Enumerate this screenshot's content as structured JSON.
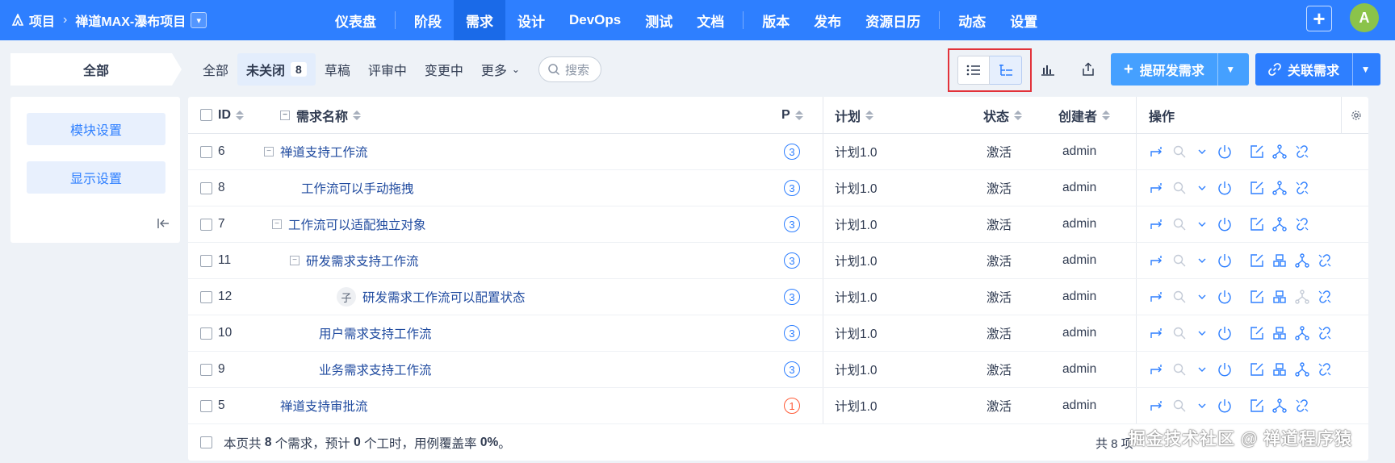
{
  "nav": {
    "crumb_project": "项目",
    "crumb_name": "禅道MAX-瀑布项目",
    "menu": [
      "仪表盘",
      "阶段",
      "需求",
      "设计",
      "DevOps",
      "测试",
      "文档",
      "版本",
      "发布",
      "资源日历",
      "动态",
      "设置"
    ],
    "active": "需求",
    "avatar": "A"
  },
  "module": {
    "all_label": "全部"
  },
  "filters": {
    "all": "全部",
    "unclosed": "未关闭",
    "unclosed_count": "8",
    "draft": "草稿",
    "reviewing": "评审中",
    "changing": "变更中",
    "more": "更多",
    "search_placeholder": "搜索"
  },
  "actions": {
    "create": "提研发需求",
    "link": "关联需求"
  },
  "sidebar": {
    "module_settings": "模块设置",
    "display_settings": "显示设置"
  },
  "table": {
    "headers": {
      "id": "ID",
      "name": "需求名称",
      "pri": "P",
      "plan": "计划",
      "status": "状态",
      "creator": "创建者",
      "actions": "操作"
    },
    "rows": [
      {
        "id": "6",
        "name": "禅道支持工作流",
        "pri": "3",
        "plan": "计划1.0",
        "status": "激活",
        "creator": "admin"
      },
      {
        "id": "8",
        "name": "工作流可以手动拖拽",
        "pri": "3",
        "plan": "计划1.0",
        "status": "激活",
        "creator": "admin"
      },
      {
        "id": "7",
        "name": "工作流可以适配独立对象",
        "pri": "3",
        "plan": "计划1.0",
        "status": "激活",
        "creator": "admin"
      },
      {
        "id": "11",
        "name": "研发需求支持工作流",
        "pri": "3",
        "plan": "计划1.0",
        "status": "激活",
        "creator": "admin"
      },
      {
        "id": "12",
        "name": "研发需求工作流可以配置状态",
        "pri": "3",
        "plan": "计划1.0",
        "status": "激活",
        "creator": "admin",
        "badge": "子"
      },
      {
        "id": "10",
        "name": "用户需求支持工作流",
        "pri": "3",
        "plan": "计划1.0",
        "status": "激活",
        "creator": "admin"
      },
      {
        "id": "9",
        "name": "业务需求支持工作流",
        "pri": "3",
        "plan": "计划1.0",
        "status": "激活",
        "creator": "admin"
      },
      {
        "id": "5",
        "name": "禅道支持审批流",
        "pri": "1",
        "plan": "计划1.0",
        "status": "激活",
        "creator": "admin"
      }
    ],
    "footer": {
      "pre": "本页共",
      "count": "8",
      "mid1": "个需求，预计",
      "hours": "0",
      "mid2": "个工时，用例覆盖率",
      "coverage": "0%",
      "end": "。"
    },
    "pager_partial": "共 8 项"
  },
  "watermark": "掘金技术社区 @ 禅道程序猿",
  "colors": {
    "primary": "#2e7fff",
    "highlight_border": "#e2323a",
    "p1": "#ff5c39"
  }
}
